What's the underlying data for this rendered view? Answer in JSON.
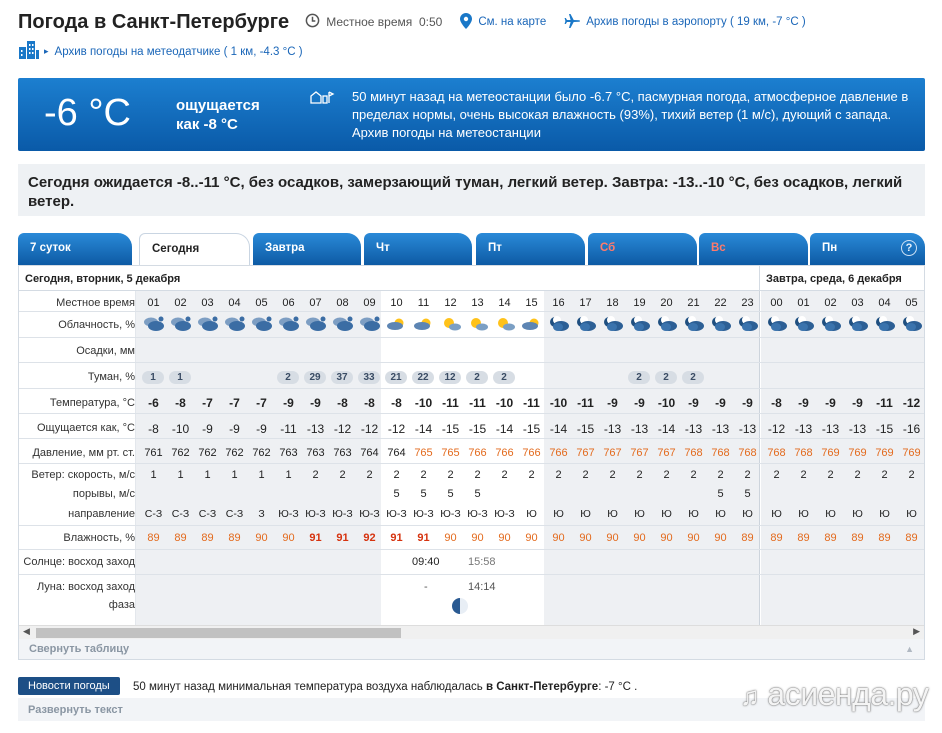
{
  "header": {
    "title": "Погода в Санкт-Петербурге",
    "local_time_label": "Местное время",
    "local_time": "0:50",
    "map_link": "См. на карте",
    "airport_archive": "Архив погоды в аэропорту ( 19 км, -7 °C )",
    "station_archive": "Архив погоды на метеодатчике ( 1 км, -4.3 °C )"
  },
  "current": {
    "temp": "-6 °C",
    "feels_line1": "ощущается",
    "feels_line2": "как -8 °C",
    "description": "50 минут назад на метеостанции было -6.7 °C, пасмурная погода, атмосферное давление в пределах нормы, очень высокая влажность (93%), тихий ветер (1 м/с), дующий с запада. Архив погоды на метеостанции"
  },
  "summary": "Сегодня ожидается -8..-11 °C, без осадков, замерзающий туман, легкий ветер. Завтра: -13..-10 °C, без осадков, легкий ветер.",
  "tabs": [
    {
      "label": "7 суток",
      "red": false
    },
    {
      "label": "Сегодня",
      "red": false
    },
    {
      "label": "Завтра",
      "red": false
    },
    {
      "label": "Чт",
      "red": false
    },
    {
      "label": "Пт",
      "red": false
    },
    {
      "label": "Сб",
      "red": true
    },
    {
      "label": "Вс",
      "red": true
    },
    {
      "label": "Пн",
      "red": false
    }
  ],
  "help_label": "?",
  "table": {
    "day1": "Сегодня, вторник, 5 декабря",
    "day2": "Завтра, среда, 6 декабря",
    "row_labels": {
      "time": "Местное время",
      "clouds": "Облачность, %",
      "precip": "Осадки, мм",
      "fog": "Туман, %",
      "temp": "Температура, °C",
      "feels": "Ощущается как, °C",
      "pressure": "Давление, мм рт. ст.",
      "wind_speed": "Ветер: скорость, м/с",
      "gusts": "порывы, м/с",
      "direction": "направление",
      "humidity": "Влажность, %",
      "sun": "Солнце: восход заход",
      "moon": "Луна: восход заход",
      "phase": "фаза"
    },
    "hours": [
      "01",
      "02",
      "03",
      "04",
      "05",
      "06",
      "07",
      "08",
      "09",
      "10",
      "11",
      "12",
      "13",
      "14",
      "15",
      "16",
      "17",
      "18",
      "19",
      "20",
      "21",
      "22",
      "23",
      "00",
      "01",
      "02",
      "03",
      "04",
      "05"
    ],
    "cloud_icons": [
      "cloudy-sky-icon",
      "cloudy-sky-icon",
      "cloudy-sky-icon",
      "cloudy-sky-icon",
      "cloudy-sky-icon",
      "cloudy-sky-icon",
      "cloudy-sky-icon",
      "cloudy-sky-icon",
      "cloudy-sky-icon",
      "partly-cloudy-icon",
      "partly-cloudy-icon",
      "sun-cloud-icon",
      "sun-cloud-icon",
      "sun-cloud-icon",
      "partly-cloudy-icon",
      "night-cloud-icon",
      "night-cloud-icon",
      "night-cloud-icon",
      "night-cloud-icon",
      "night-cloud-icon",
      "night-cloud-icon",
      "night-cloud-icon",
      "night-cloud-icon",
      "night-cloud-icon",
      "night-cloud-icon",
      "night-cloud-icon",
      "night-cloud-icon",
      "night-cloud-icon",
      "night-cloud-icon"
    ],
    "fog": [
      "1",
      "1",
      "",
      "",
      "",
      "2",
      "29",
      "37",
      "33",
      "21",
      "22",
      "12",
      "2",
      "2",
      "",
      "",
      "",
      "",
      "2",
      "2",
      "2",
      "",
      "",
      "",
      "",
      "",
      "",
      "",
      ""
    ],
    "temp": [
      "-6",
      "-8",
      "-7",
      "-7",
      "-7",
      "-9",
      "-9",
      "-8",
      "-8",
      "-8",
      "-10",
      "-11",
      "-11",
      "-10",
      "-11",
      "-10",
      "-11",
      "-9",
      "-9",
      "-10",
      "-9",
      "-9",
      "-9",
      "-8",
      "-9",
      "-9",
      "-9",
      "-11",
      "-12"
    ],
    "feels": [
      "-8",
      "-10",
      "-9",
      "-9",
      "-9",
      "-11",
      "-13",
      "-12",
      "-12",
      "-12",
      "-14",
      "-15",
      "-15",
      "-14",
      "-15",
      "-14",
      "-15",
      "-13",
      "-13",
      "-14",
      "-13",
      "-13",
      "-13",
      "-12",
      "-13",
      "-13",
      "-13",
      "-15",
      "-16"
    ],
    "pressure": [
      "761",
      "762",
      "762",
      "762",
      "762",
      "763",
      "763",
      "763",
      "764",
      "764",
      "765",
      "765",
      "766",
      "766",
      "766",
      "766",
      "767",
      "767",
      "767",
      "767",
      "768",
      "768",
      "768",
      "768",
      "768",
      "769",
      "769",
      "769",
      "769"
    ],
    "wind_speed": [
      "1",
      "1",
      "1",
      "1",
      "1",
      "1",
      "2",
      "2",
      "2",
      "2",
      "2",
      "2",
      "2",
      "2",
      "2",
      "2",
      "2",
      "2",
      "2",
      "2",
      "2",
      "2",
      "2",
      "2",
      "2",
      "2",
      "2",
      "2",
      "2"
    ],
    "gusts": [
      "",
      "",
      "",
      "",
      "",
      "",
      "",
      "",
      "",
      "5",
      "5",
      "5",
      "5",
      "",
      "",
      "",
      "",
      "",
      "",
      "",
      "",
      "5",
      "5",
      "",
      "",
      "",
      "",
      "",
      ""
    ],
    "direction": [
      "С-З",
      "С-З",
      "С-З",
      "С-З",
      "З",
      "Ю-З",
      "Ю-З",
      "Ю-З",
      "Ю-З",
      "Ю-З",
      "Ю-З",
      "Ю-З",
      "Ю-З",
      "Ю-З",
      "Ю",
      "Ю",
      "Ю",
      "Ю",
      "Ю",
      "Ю",
      "Ю",
      "Ю",
      "Ю",
      "Ю",
      "Ю",
      "Ю",
      "Ю",
      "Ю",
      "Ю"
    ],
    "humidity": [
      "89",
      "89",
      "89",
      "89",
      "90",
      "90",
      "91",
      "91",
      "92",
      "91",
      "91",
      "90",
      "90",
      "90",
      "90",
      "90",
      "90",
      "90",
      "90",
      "90",
      "90",
      "90",
      "89",
      "89",
      "89",
      "89",
      "89",
      "89",
      "89"
    ],
    "sunrise": "09:40",
    "sunset": "15:58",
    "moonrise": "-",
    "moonset": "14:14"
  },
  "collapse_label": "Свернуть таблицу",
  "news": {
    "badge": "Новости погоды",
    "text_prefix": "50 минут назад минимальная температура воздуха наблюдалась ",
    "text_bold": "в Санкт-Петербурге",
    "text_suffix": ": -7 °C .",
    "expand_label": "Развернуть текст"
  },
  "watermark": "асиенда.ру"
}
